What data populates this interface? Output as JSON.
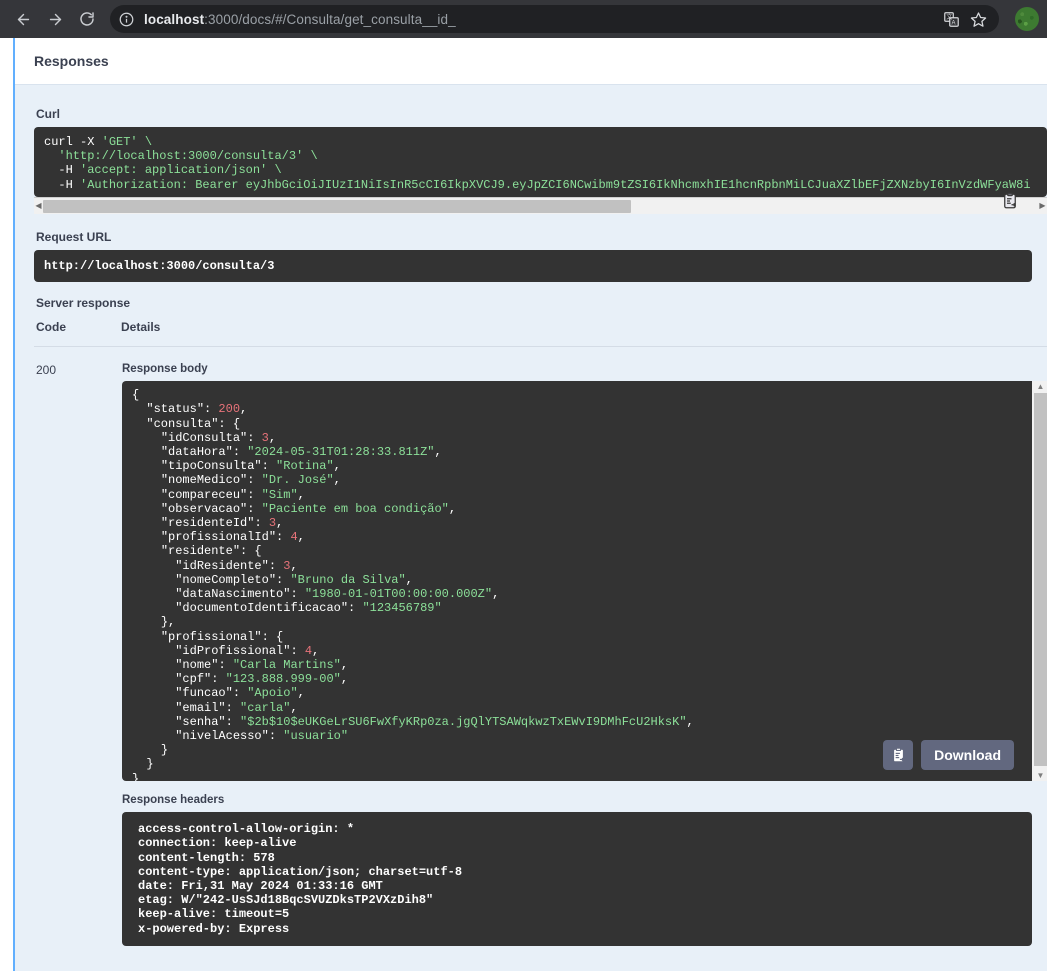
{
  "browser": {
    "back_label": "Back",
    "forward_label": "Forward",
    "reload_label": "Reload",
    "site_info_label": "View site information",
    "translate_label": "Translate this page",
    "bookmark_label": "Bookmark this tab",
    "profile_label": "Profile",
    "url_host": "localhost",
    "url_rest": ":3000/docs/#/Consulta/get_consulta__id_",
    "url_full": "localhost:3000/docs/#/Consulta/get_consulta__id_"
  },
  "responses": {
    "section_title": "Responses",
    "curl_label": "Curl",
    "curl_lines": [
      "curl -X 'GET' \\",
      "  'http://localhost:3000/consulta/3' \\",
      "  -H 'accept: application/json' \\",
      "  -H 'Authorization: Bearer eyJhbGciOiJIUzI1NiIsInR5cCI6IkpXVCJ9.eyJpZCI6NCwibm9tZSI6IkNhcmxhIE1hcnRpbnMiLCJuaXZlbEFjZXNzbyI6InVzdWFyaW8i"
    ],
    "request_url_label": "Request URL",
    "request_url": "http://localhost:3000/consulta/3",
    "server_response_label": "Server response",
    "table_headers": {
      "code": "Code",
      "details": "Details"
    },
    "code": "200",
    "response_body_label": "Response body",
    "response_body_lines": [
      "{",
      "  \"status\": 200,",
      "  \"consulta\": {",
      "    \"idConsulta\": 3,",
      "    \"dataHora\": \"2024-05-31T01:28:33.811Z\",",
      "    \"tipoConsulta\": \"Rotina\",",
      "    \"nomeMedico\": \"Dr. José\",",
      "    \"compareceu\": \"Sim\",",
      "    \"observacao\": \"Paciente em boa condição\",",
      "    \"residenteId\": 3,",
      "    \"profissionalId\": 4,",
      "    \"residente\": {",
      "      \"idResidente\": 3,",
      "      \"nomeCompleto\": \"Bruno da Silva\",",
      "      \"dataNascimento\": \"1980-01-01T00:00:00.000Z\",",
      "      \"documentoIdentificacao\": \"123456789\"",
      "    },",
      "    \"profissional\": {",
      "      \"idProfissional\": 4,",
      "      \"nome\": \"Carla Martins\",",
      "      \"cpf\": \"123.888.999-00\",",
      "      \"funcao\": \"Apoio\",",
      "      \"email\": \"carla\",",
      "      \"senha\": \"$2b$10$eUKGeLrSU6FwXfyKRp0za.jgQlYTSAWqkwzTxEWvI9DMhFcU2HksK\",",
      "      \"nivelAcesso\": \"usuario\"",
      "    }",
      "  }",
      "}"
    ],
    "copy_label": "Copy to clipboard",
    "download_label": "Download",
    "response_headers_label": "Response headers",
    "response_headers_lines": [
      "access-control-allow-origin: *",
      "connection: keep-alive",
      "content-length: 578",
      "content-type: application/json; charset=utf-8",
      "date: Fri,31 May 2024 01:33:16 GMT",
      "etag: W/\"242-UsSJd18BqcSVUZDksTP2VXzDih8\"",
      "keep-alive: timeout=5",
      "x-powered-by: Express"
    ]
  },
  "colors": {
    "accent_blue": "#61affe",
    "panel_bg": "#e8f0f8",
    "code_bg": "#333333",
    "string_green": "#8ce099",
    "number_red": "#e8737a",
    "button_gray": "#62687f"
  }
}
